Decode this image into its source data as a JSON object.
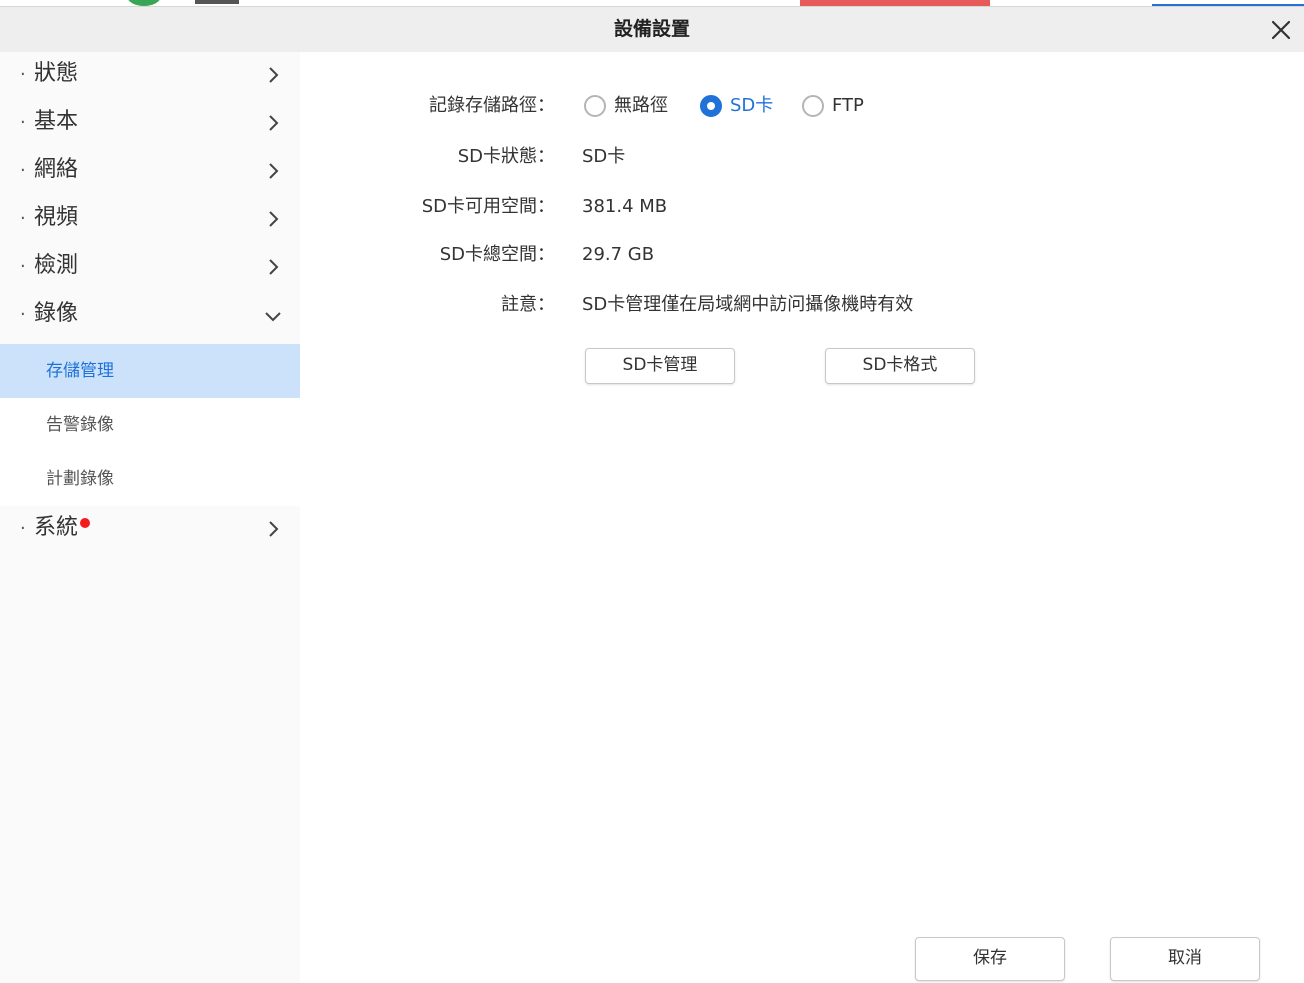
{
  "dialog": {
    "title": "設備設置"
  },
  "sidebar": {
    "items": [
      {
        "label": "狀態",
        "expanded": false
      },
      {
        "label": "基本",
        "expanded": false
      },
      {
        "label": "網絡",
        "expanded": false
      },
      {
        "label": "視頻",
        "expanded": false
      },
      {
        "label": "檢測",
        "expanded": false
      },
      {
        "label": "錄像",
        "expanded": true
      },
      {
        "label": "系統",
        "expanded": false,
        "badge": true
      }
    ],
    "lead_char": "·",
    "record_subitems": [
      {
        "label": "存儲管理",
        "active": true
      },
      {
        "label": "告警錄像",
        "active": false
      },
      {
        "label": "計劃錄像",
        "active": false
      }
    ]
  },
  "form": {
    "path_label": "記錄存儲路徑：",
    "path_options": [
      {
        "label": "無路徑",
        "checked": false
      },
      {
        "label": "SD卡",
        "checked": true
      },
      {
        "label": "FTP",
        "checked": false
      }
    ],
    "sd_status_label": "SD卡狀態：",
    "sd_status_value": "SD卡",
    "sd_free_label": "SD卡可用空間：",
    "sd_free_value": "381.4 MB",
    "sd_total_label": "SD卡總空間：",
    "sd_total_value": "29.7 GB",
    "note_label": "註意：",
    "note_value": "SD卡管理僅在局域網中訪问攝像機時有效",
    "sd_manage_button": "SD卡管理",
    "sd_format_button": "SD卡格式"
  },
  "footer": {
    "save_label": "保存",
    "cancel_label": "取消"
  },
  "colors": {
    "accent": "#1f73d8",
    "active_bg": "#cce2fb",
    "badge": "#f31c1c"
  }
}
